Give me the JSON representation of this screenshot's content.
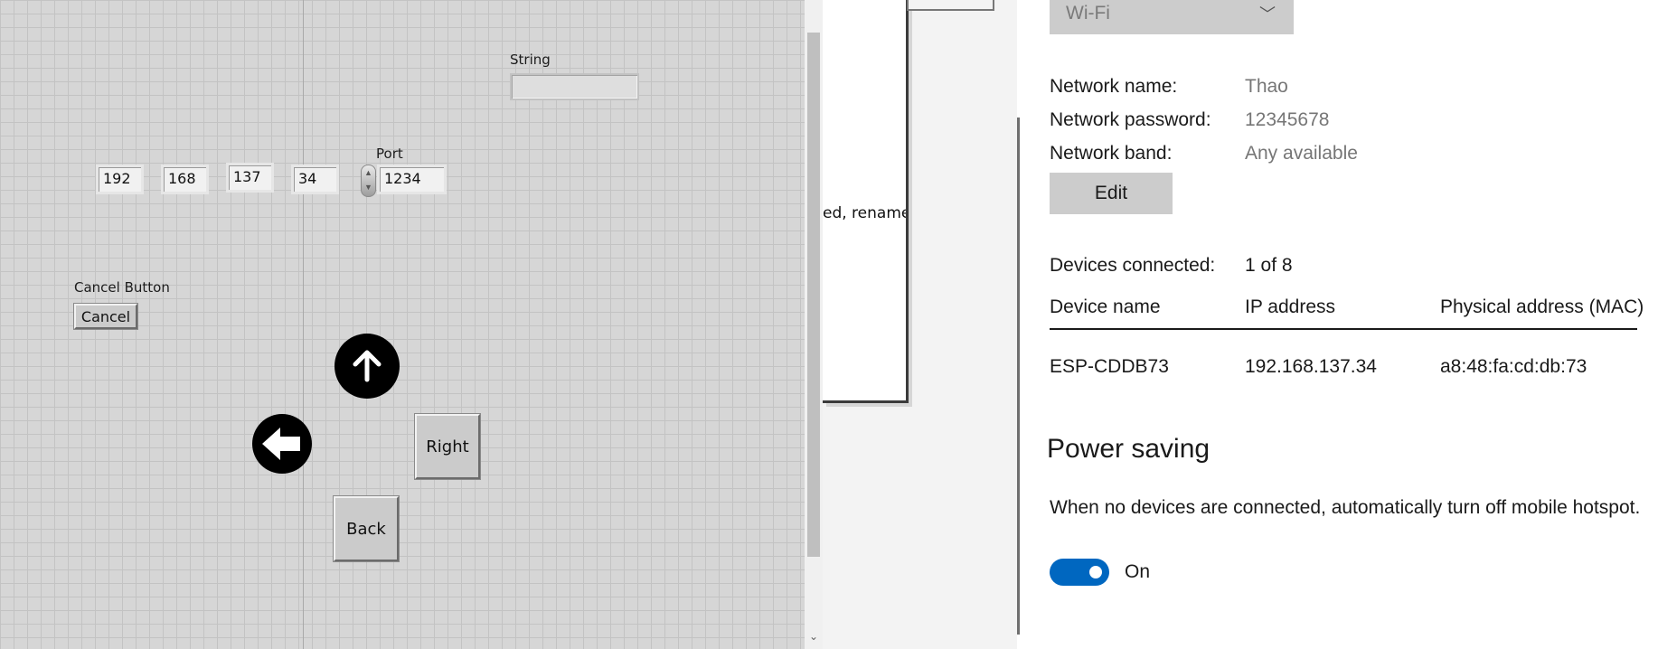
{
  "labview": {
    "string_label": "String",
    "port_label": "Port",
    "ip": [
      "192",
      "168",
      "137",
      "34"
    ],
    "port_value": "1234",
    "cancel_label": "Cancel Button",
    "cancel_button": "Cancel",
    "right_button": "Right",
    "back_button": "Back",
    "icons": {
      "up": "arrow-up-icon",
      "left": "arrow-left-icon"
    }
  },
  "middle_window": {
    "partial_text": "ed, rename"
  },
  "settings": {
    "network_type": "Wi-Fi",
    "network_name_label": "Network name:",
    "network_name": "Thao",
    "network_password_label": "Network password:",
    "network_password": "12345678",
    "network_band_label": "Network band:",
    "network_band": "Any available",
    "edit_button": "Edit",
    "devices_connected_label": "Devices connected:",
    "devices_connected": "1 of 8",
    "columns": [
      "Device name",
      "IP address",
      "Physical address (MAC)"
    ],
    "devices": [
      {
        "name": "ESP-CDDB73",
        "ip": "192.168.137.34",
        "mac": "a8:48:fa:cd:db:73"
      }
    ],
    "power_saving_title": "Power saving",
    "power_saving_desc": "When no devices are connected, automatically turn off mobile hotspot.",
    "toggle_state": "On",
    "accent_color": "#0067c0"
  }
}
